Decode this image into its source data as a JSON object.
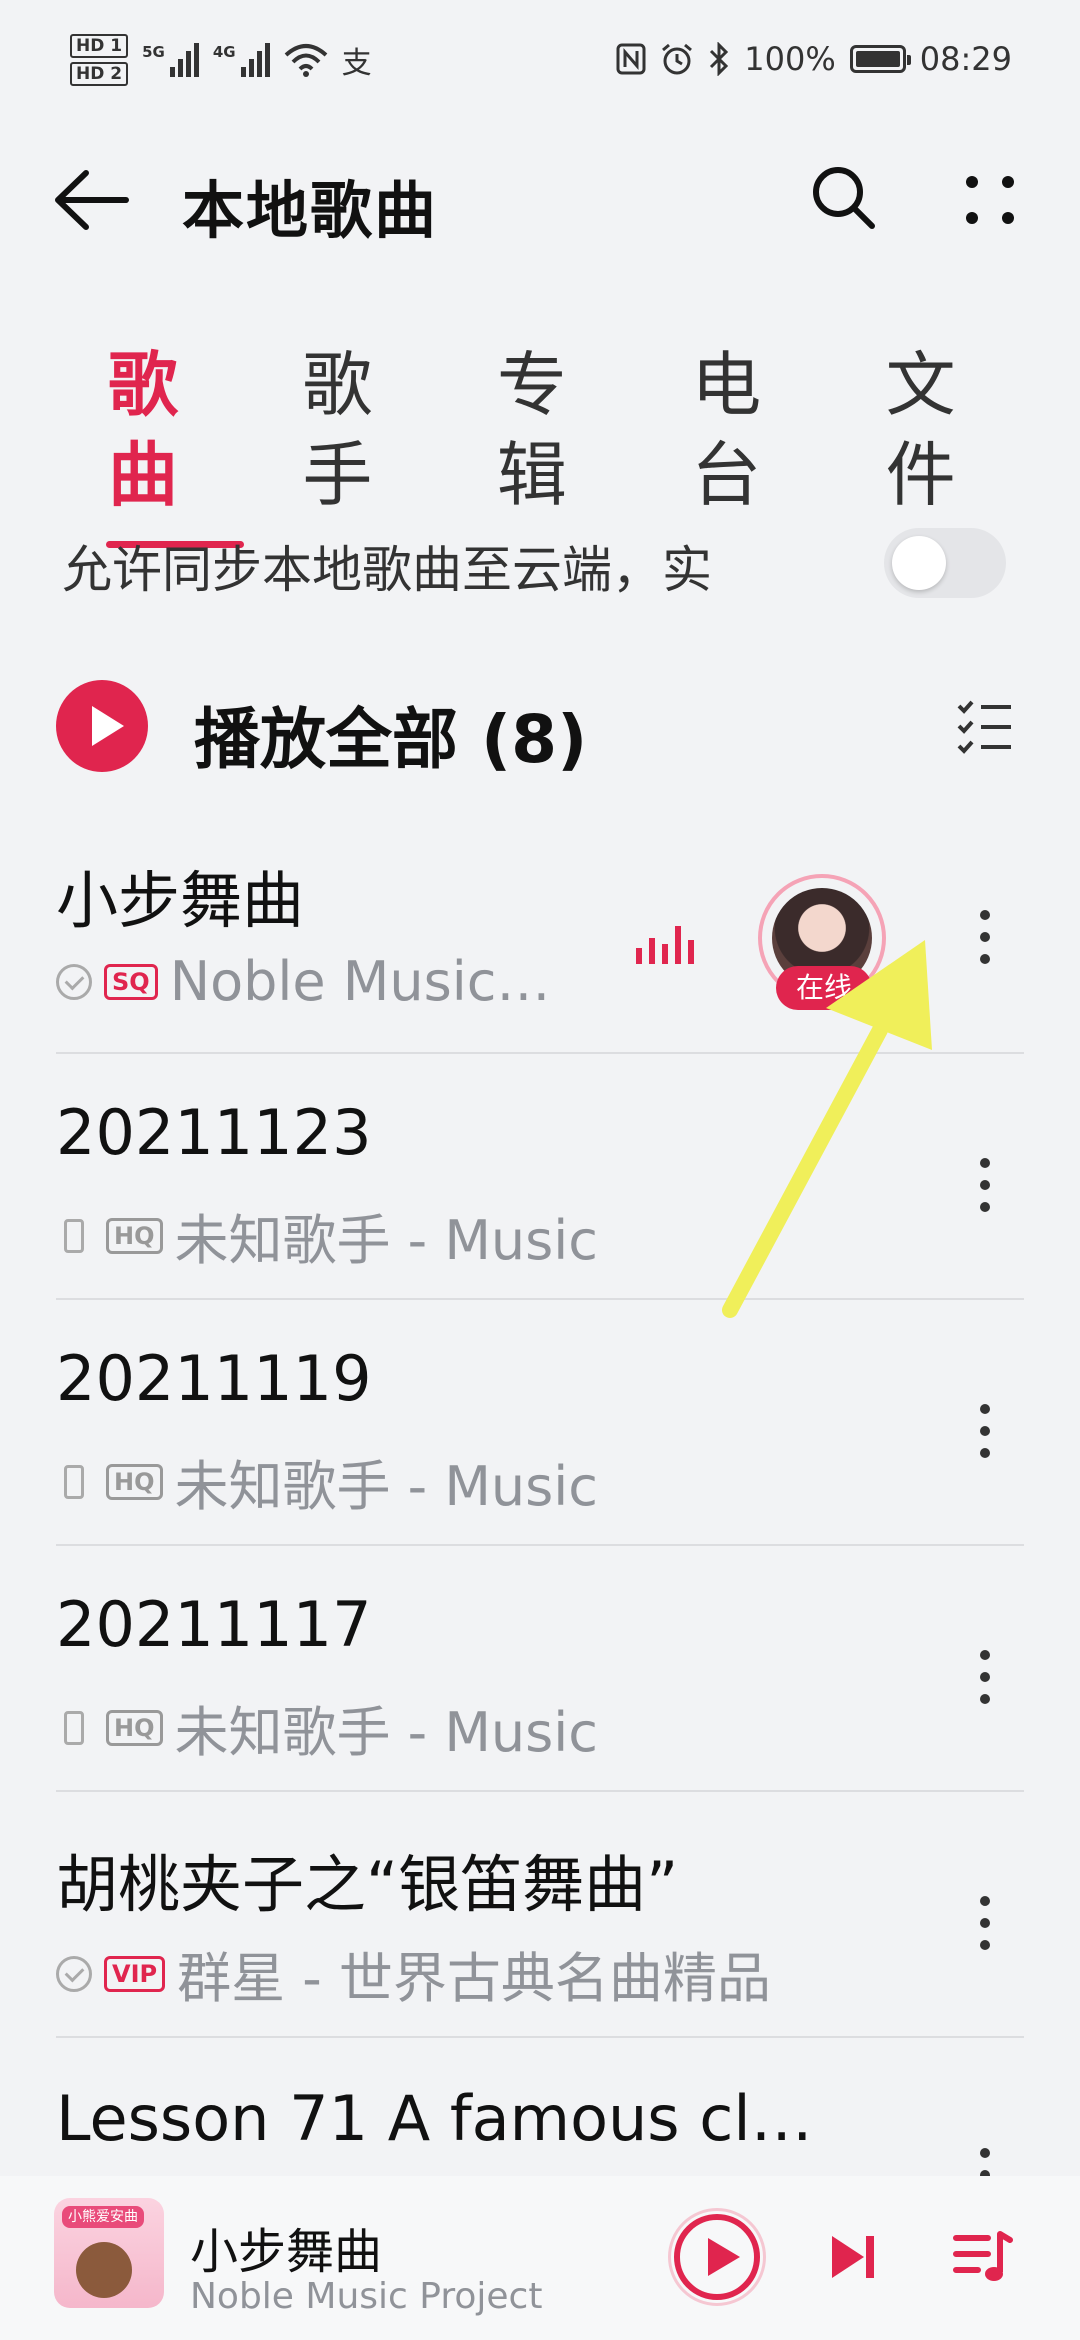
{
  "status_bar": {
    "hd1": "HD 1",
    "hd2": "HD 2",
    "net1": "5G",
    "net2": "4G",
    "pay_icon": "支",
    "battery": "100%",
    "time": "08:29"
  },
  "header": {
    "title": "本地歌曲"
  },
  "tabs": [
    "歌曲",
    "歌手",
    "专辑",
    "电台",
    "文件"
  ],
  "sync": {
    "label": "允许同步本地歌曲至云端，实",
    "enabled": false
  },
  "play_all": {
    "label": "播放全部 (8)"
  },
  "songs": [
    {
      "title": "小步舞曲",
      "badge": "SQ",
      "subtitle": "Noble Music…",
      "playing": true,
      "online_label": "在线"
    },
    {
      "title": "20211123",
      "badge": "HQ",
      "subtitle": "未知歌手 - Music"
    },
    {
      "title": "20211119",
      "badge": "HQ",
      "subtitle": "未知歌手 - Music"
    },
    {
      "title": "20211117",
      "badge": "HQ",
      "subtitle": "未知歌手 - Music"
    },
    {
      "title": "胡桃夹子之“银笛舞曲”",
      "badge": "VIP",
      "subtitle": "群星 - 世界古典名曲精品"
    },
    {
      "title": "Lesson 71 A famous cl…"
    }
  ],
  "player": {
    "title": "小步舞曲",
    "artist": "Noble Music Project",
    "cover_tag": "小熊爱安曲"
  },
  "colors": {
    "accent": "#e0254e",
    "annotation_arrow": "#f0ef5a"
  }
}
